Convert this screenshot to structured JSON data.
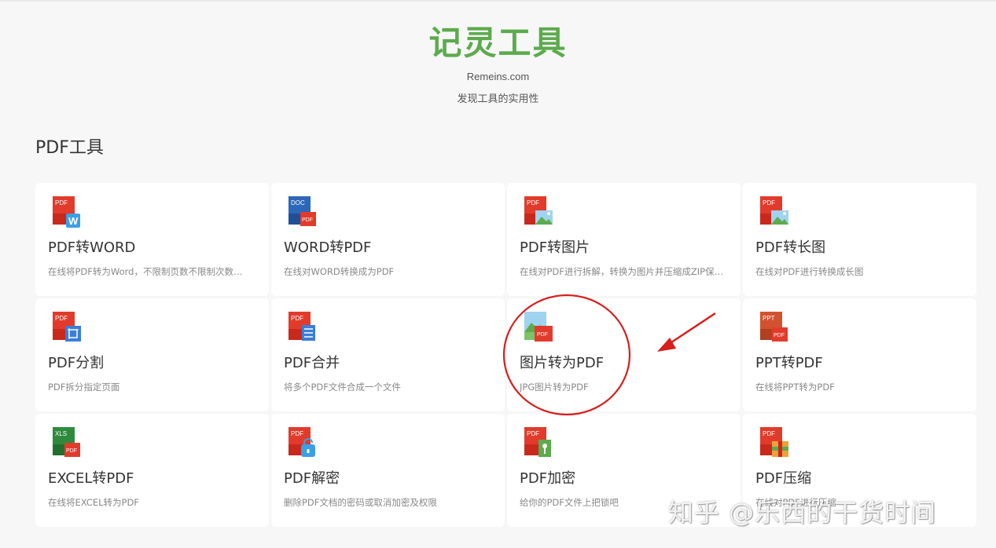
{
  "header": {
    "title": "记灵工具",
    "domain": "Remeins.com",
    "slogan": "发现工具的实用性"
  },
  "section": {
    "title": "PDF工具"
  },
  "colors": {
    "brand_green": "#5cab4d",
    "pdf_red": "#e23b2b",
    "word_blue": "#2c67b9",
    "excel_green": "#2e8b3d",
    "annotation_red": "#d81e1e"
  },
  "tools": [
    {
      "name": "PDF转WORD",
      "desc": "在线将PDF转为Word，不限制页数不限制次数…",
      "icon": "pdf-to-word-icon"
    },
    {
      "name": "WORD转PDF",
      "desc": "在线对WORD转换成为PDF",
      "icon": "word-to-pdf-icon"
    },
    {
      "name": "PDF转图片",
      "desc": "在线对PDF进行拆解，转换为图片并压缩成ZIP保…",
      "icon": "pdf-to-image-icon"
    },
    {
      "name": "PDF转长图",
      "desc": "在线对PDF进行转换成长图",
      "icon": "pdf-to-long-image-icon"
    },
    {
      "name": "PDF分割",
      "desc": "PDF拆分指定页面",
      "icon": "pdf-split-icon"
    },
    {
      "name": "PDF合并",
      "desc": "将多个PDF文件合成一个文件",
      "icon": "pdf-merge-icon"
    },
    {
      "name": "图片转为PDF",
      "desc": "JPG图片转为PDF",
      "icon": "image-to-pdf-icon"
    },
    {
      "name": "PPT转PDF",
      "desc": "在线将PPT转为PDF",
      "icon": "ppt-to-pdf-icon"
    },
    {
      "name": "EXCEL转PDF",
      "desc": "在线将EXCEL转为PDF",
      "icon": "excel-to-pdf-icon"
    },
    {
      "name": "PDF解密",
      "desc": "删除PDF文档的密码或取消加密及权限",
      "icon": "pdf-decrypt-icon"
    },
    {
      "name": "PDF加密",
      "desc": "给你的PDF文件上把锁吧",
      "icon": "pdf-encrypt-icon"
    },
    {
      "name": "PDF压缩",
      "desc": "在线对PDF进行压缩",
      "icon": "pdf-compress-icon"
    }
  ],
  "icon_labels": {
    "pdf": "PDF",
    "doc": "DOC",
    "xls": "XLS",
    "ppt": "PPT",
    "w": "W"
  },
  "watermark": "知乎 @乐西的干货时间"
}
